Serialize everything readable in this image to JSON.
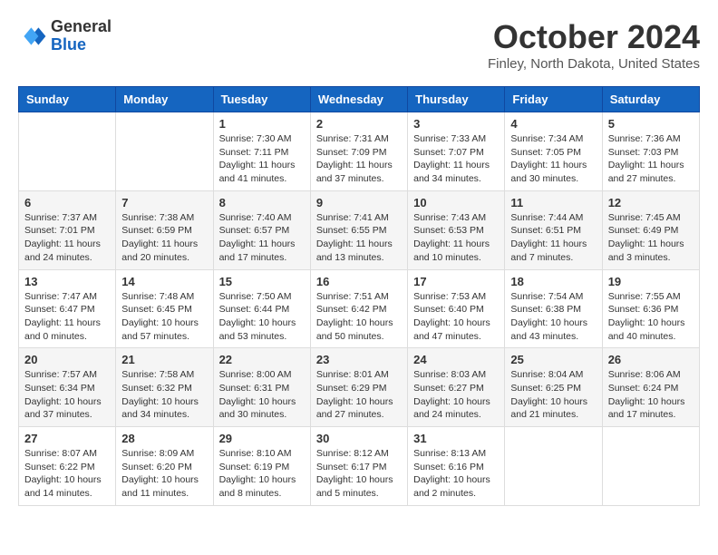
{
  "header": {
    "logo_general": "General",
    "logo_blue": "Blue",
    "month_year": "October 2024",
    "location": "Finley, North Dakota, United States"
  },
  "days_of_week": [
    "Sunday",
    "Monday",
    "Tuesday",
    "Wednesday",
    "Thursday",
    "Friday",
    "Saturday"
  ],
  "weeks": [
    [
      {
        "day": "",
        "info": ""
      },
      {
        "day": "",
        "info": ""
      },
      {
        "day": "1",
        "info": "Sunrise: 7:30 AM\nSunset: 7:11 PM\nDaylight: 11 hours and 41 minutes."
      },
      {
        "day": "2",
        "info": "Sunrise: 7:31 AM\nSunset: 7:09 PM\nDaylight: 11 hours and 37 minutes."
      },
      {
        "day": "3",
        "info": "Sunrise: 7:33 AM\nSunset: 7:07 PM\nDaylight: 11 hours and 34 minutes."
      },
      {
        "day": "4",
        "info": "Sunrise: 7:34 AM\nSunset: 7:05 PM\nDaylight: 11 hours and 30 minutes."
      },
      {
        "day": "5",
        "info": "Sunrise: 7:36 AM\nSunset: 7:03 PM\nDaylight: 11 hours and 27 minutes."
      }
    ],
    [
      {
        "day": "6",
        "info": "Sunrise: 7:37 AM\nSunset: 7:01 PM\nDaylight: 11 hours and 24 minutes."
      },
      {
        "day": "7",
        "info": "Sunrise: 7:38 AM\nSunset: 6:59 PM\nDaylight: 11 hours and 20 minutes."
      },
      {
        "day": "8",
        "info": "Sunrise: 7:40 AM\nSunset: 6:57 PM\nDaylight: 11 hours and 17 minutes."
      },
      {
        "day": "9",
        "info": "Sunrise: 7:41 AM\nSunset: 6:55 PM\nDaylight: 11 hours and 13 minutes."
      },
      {
        "day": "10",
        "info": "Sunrise: 7:43 AM\nSunset: 6:53 PM\nDaylight: 11 hours and 10 minutes."
      },
      {
        "day": "11",
        "info": "Sunrise: 7:44 AM\nSunset: 6:51 PM\nDaylight: 11 hours and 7 minutes."
      },
      {
        "day": "12",
        "info": "Sunrise: 7:45 AM\nSunset: 6:49 PM\nDaylight: 11 hours and 3 minutes."
      }
    ],
    [
      {
        "day": "13",
        "info": "Sunrise: 7:47 AM\nSunset: 6:47 PM\nDaylight: 11 hours and 0 minutes."
      },
      {
        "day": "14",
        "info": "Sunrise: 7:48 AM\nSunset: 6:45 PM\nDaylight: 10 hours and 57 minutes."
      },
      {
        "day": "15",
        "info": "Sunrise: 7:50 AM\nSunset: 6:44 PM\nDaylight: 10 hours and 53 minutes."
      },
      {
        "day": "16",
        "info": "Sunrise: 7:51 AM\nSunset: 6:42 PM\nDaylight: 10 hours and 50 minutes."
      },
      {
        "day": "17",
        "info": "Sunrise: 7:53 AM\nSunset: 6:40 PM\nDaylight: 10 hours and 47 minutes."
      },
      {
        "day": "18",
        "info": "Sunrise: 7:54 AM\nSunset: 6:38 PM\nDaylight: 10 hours and 43 minutes."
      },
      {
        "day": "19",
        "info": "Sunrise: 7:55 AM\nSunset: 6:36 PM\nDaylight: 10 hours and 40 minutes."
      }
    ],
    [
      {
        "day": "20",
        "info": "Sunrise: 7:57 AM\nSunset: 6:34 PM\nDaylight: 10 hours and 37 minutes."
      },
      {
        "day": "21",
        "info": "Sunrise: 7:58 AM\nSunset: 6:32 PM\nDaylight: 10 hours and 34 minutes."
      },
      {
        "day": "22",
        "info": "Sunrise: 8:00 AM\nSunset: 6:31 PM\nDaylight: 10 hours and 30 minutes."
      },
      {
        "day": "23",
        "info": "Sunrise: 8:01 AM\nSunset: 6:29 PM\nDaylight: 10 hours and 27 minutes."
      },
      {
        "day": "24",
        "info": "Sunrise: 8:03 AM\nSunset: 6:27 PM\nDaylight: 10 hours and 24 minutes."
      },
      {
        "day": "25",
        "info": "Sunrise: 8:04 AM\nSunset: 6:25 PM\nDaylight: 10 hours and 21 minutes."
      },
      {
        "day": "26",
        "info": "Sunrise: 8:06 AM\nSunset: 6:24 PM\nDaylight: 10 hours and 17 minutes."
      }
    ],
    [
      {
        "day": "27",
        "info": "Sunrise: 8:07 AM\nSunset: 6:22 PM\nDaylight: 10 hours and 14 minutes."
      },
      {
        "day": "28",
        "info": "Sunrise: 8:09 AM\nSunset: 6:20 PM\nDaylight: 10 hours and 11 minutes."
      },
      {
        "day": "29",
        "info": "Sunrise: 8:10 AM\nSunset: 6:19 PM\nDaylight: 10 hours and 8 minutes."
      },
      {
        "day": "30",
        "info": "Sunrise: 8:12 AM\nSunset: 6:17 PM\nDaylight: 10 hours and 5 minutes."
      },
      {
        "day": "31",
        "info": "Sunrise: 8:13 AM\nSunset: 6:16 PM\nDaylight: 10 hours and 2 minutes."
      },
      {
        "day": "",
        "info": ""
      },
      {
        "day": "",
        "info": ""
      }
    ]
  ]
}
